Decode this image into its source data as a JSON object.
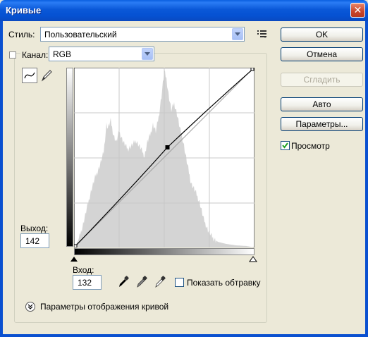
{
  "window": {
    "title": "Кривые",
    "close_glyph": "✕"
  },
  "style_row": {
    "label": "Стиль:",
    "value": "Пользовательский"
  },
  "channel_row": {
    "label": "Канал:",
    "value": "RGB"
  },
  "output": {
    "label": "Выход:",
    "value": "142"
  },
  "input": {
    "label": "Вход:",
    "value": "132"
  },
  "buttons": {
    "ok": "OK",
    "cancel": "Отмена",
    "smooth": "Сгладить",
    "auto": "Авто",
    "params": "Параметры..."
  },
  "preview": {
    "label": "Просмотр",
    "checked": true
  },
  "clipping": {
    "label": "Показать обтравку",
    "checked": false
  },
  "display_options": {
    "label": "Параметры отображения кривой"
  },
  "curve": {
    "input_level": 132,
    "output_level": 142
  }
}
